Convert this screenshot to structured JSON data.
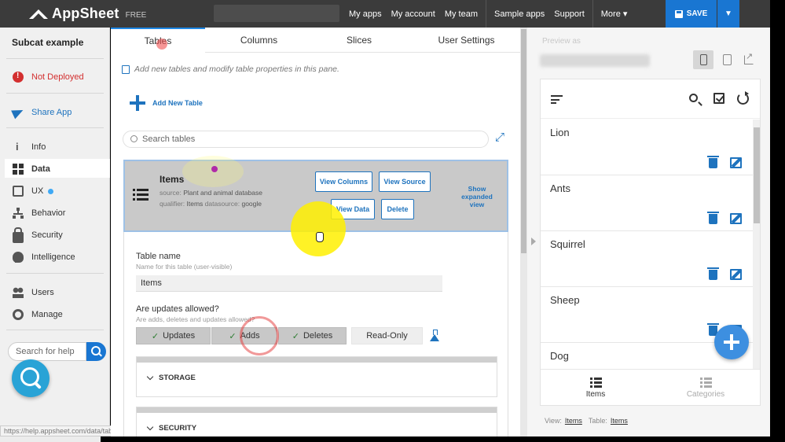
{
  "topbar": {
    "brand": "AppSheet",
    "plan": "FREE",
    "nav": [
      "My apps",
      "My account",
      "My team",
      "Sample apps",
      "Support",
      "More"
    ],
    "save_label": "SAVE"
  },
  "sidebar": {
    "app_name": "Subcat example",
    "deploy_status": "Not Deployed",
    "share": "Share App",
    "items": [
      "Info",
      "Data",
      "UX",
      "Behavior",
      "Security",
      "Intelligence"
    ],
    "items2": [
      "Users",
      "Manage"
    ],
    "help_placeholder": "Search for help",
    "status_url": "https://help.appsheet.com/data/tables"
  },
  "center": {
    "tabs": [
      "Tables",
      "Columns",
      "Slices",
      "User Settings"
    ],
    "hint": "Add new tables and modify table properties in this pane.",
    "add_table": "Add New Table",
    "search_placeholder": "Search tables",
    "table": {
      "name": "Items",
      "source_label": "source:",
      "source_value": "Plant and animal",
      "source_suffix": "database",
      "qualifier_label": "qualifier:",
      "qualifier_value": "Items",
      "datasource_label": "datasource:",
      "datasource_value": "google",
      "buttons": {
        "view_columns": "View Columns",
        "view_source": "View Source",
        "view_data": "View Data",
        "delete": "Delete"
      },
      "show_expanded": "Show expanded view"
    },
    "detail": {
      "table_name_label": "Table name",
      "table_name_sub": "Name for this table (user-visible)",
      "table_name_value": "Items",
      "updates_label": "Are updates allowed?",
      "updates_sub": "Are adds, deletes and updates allowed?",
      "options": [
        "Updates",
        "Adds",
        "Deletes",
        "Read-Only"
      ],
      "sections": [
        "STORAGE",
        "SECURITY"
      ]
    }
  },
  "preview": {
    "title": "Preview as",
    "rows": [
      "Lion",
      "Ants",
      "Squirrel",
      "Sheep",
      "Dog"
    ],
    "bottom_nav": [
      "Items",
      "Categories"
    ],
    "footer": {
      "view_label": "View:",
      "view_value": "Items",
      "table_label": "Table:",
      "table_value": "Items"
    }
  },
  "colors": {
    "topbar": "#3b3b3b",
    "accent": "#1976d2",
    "error": "#d32f2f",
    "highlight": "#fff000"
  }
}
